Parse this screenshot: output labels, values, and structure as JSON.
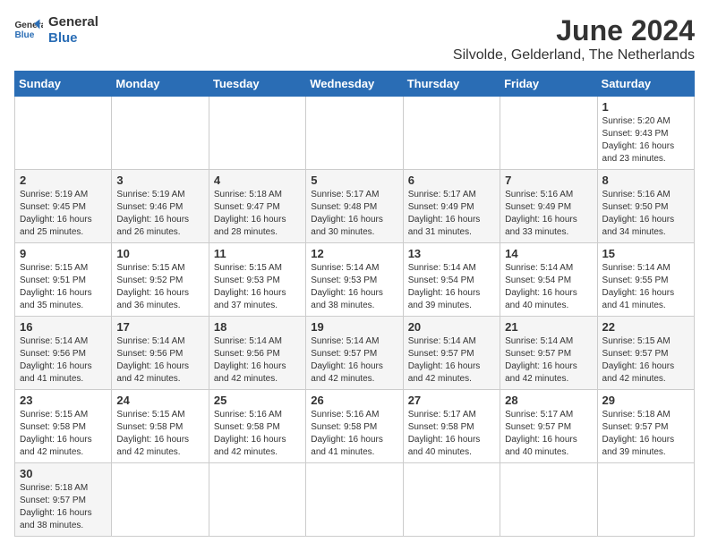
{
  "logo": {
    "line1": "General",
    "line2": "Blue"
  },
  "title": "June 2024",
  "subtitle": "Silvolde, Gelderland, The Netherlands",
  "weekdays": [
    "Sunday",
    "Monday",
    "Tuesday",
    "Wednesday",
    "Thursday",
    "Friday",
    "Saturday"
  ],
  "weeks": [
    [
      null,
      null,
      null,
      null,
      null,
      null,
      {
        "day": "1",
        "info": "Sunrise: 5:20 AM\nSunset: 9:43 PM\nDaylight: 16 hours\nand 23 minutes."
      }
    ],
    [
      {
        "day": "2",
        "info": "Sunrise: 5:19 AM\nSunset: 9:45 PM\nDaylight: 16 hours\nand 25 minutes."
      },
      {
        "day": "3",
        "info": "Sunrise: 5:19 AM\nSunset: 9:46 PM\nDaylight: 16 hours\nand 26 minutes."
      },
      {
        "day": "4",
        "info": "Sunrise: 5:18 AM\nSunset: 9:47 PM\nDaylight: 16 hours\nand 28 minutes."
      },
      {
        "day": "5",
        "info": "Sunrise: 5:17 AM\nSunset: 9:48 PM\nDaylight: 16 hours\nand 30 minutes."
      },
      {
        "day": "6",
        "info": "Sunrise: 5:17 AM\nSunset: 9:49 PM\nDaylight: 16 hours\nand 31 minutes."
      },
      {
        "day": "7",
        "info": "Sunrise: 5:16 AM\nSunset: 9:49 PM\nDaylight: 16 hours\nand 33 minutes."
      },
      {
        "day": "8",
        "info": "Sunrise: 5:16 AM\nSunset: 9:50 PM\nDaylight: 16 hours\nand 34 minutes."
      }
    ],
    [
      {
        "day": "9",
        "info": "Sunrise: 5:15 AM\nSunset: 9:51 PM\nDaylight: 16 hours\nand 35 minutes."
      },
      {
        "day": "10",
        "info": "Sunrise: 5:15 AM\nSunset: 9:52 PM\nDaylight: 16 hours\nand 36 minutes."
      },
      {
        "day": "11",
        "info": "Sunrise: 5:15 AM\nSunset: 9:53 PM\nDaylight: 16 hours\nand 37 minutes."
      },
      {
        "day": "12",
        "info": "Sunrise: 5:14 AM\nSunset: 9:53 PM\nDaylight: 16 hours\nand 38 minutes."
      },
      {
        "day": "13",
        "info": "Sunrise: 5:14 AM\nSunset: 9:54 PM\nDaylight: 16 hours\nand 39 minutes."
      },
      {
        "day": "14",
        "info": "Sunrise: 5:14 AM\nSunset: 9:54 PM\nDaylight: 16 hours\nand 40 minutes."
      },
      {
        "day": "15",
        "info": "Sunrise: 5:14 AM\nSunset: 9:55 PM\nDaylight: 16 hours\nand 41 minutes."
      }
    ],
    [
      {
        "day": "16",
        "info": "Sunrise: 5:14 AM\nSunset: 9:56 PM\nDaylight: 16 hours\nand 41 minutes."
      },
      {
        "day": "17",
        "info": "Sunrise: 5:14 AM\nSunset: 9:56 PM\nDaylight: 16 hours\nand 42 minutes."
      },
      {
        "day": "18",
        "info": "Sunrise: 5:14 AM\nSunset: 9:56 PM\nDaylight: 16 hours\nand 42 minutes."
      },
      {
        "day": "19",
        "info": "Sunrise: 5:14 AM\nSunset: 9:57 PM\nDaylight: 16 hours\nand 42 minutes."
      },
      {
        "day": "20",
        "info": "Sunrise: 5:14 AM\nSunset: 9:57 PM\nDaylight: 16 hours\nand 42 minutes."
      },
      {
        "day": "21",
        "info": "Sunrise: 5:14 AM\nSunset: 9:57 PM\nDaylight: 16 hours\nand 42 minutes."
      },
      {
        "day": "22",
        "info": "Sunrise: 5:15 AM\nSunset: 9:57 PM\nDaylight: 16 hours\nand 42 minutes."
      }
    ],
    [
      {
        "day": "23",
        "info": "Sunrise: 5:15 AM\nSunset: 9:58 PM\nDaylight: 16 hours\nand 42 minutes."
      },
      {
        "day": "24",
        "info": "Sunrise: 5:15 AM\nSunset: 9:58 PM\nDaylight: 16 hours\nand 42 minutes."
      },
      {
        "day": "25",
        "info": "Sunrise: 5:16 AM\nSunset: 9:58 PM\nDaylight: 16 hours\nand 42 minutes."
      },
      {
        "day": "26",
        "info": "Sunrise: 5:16 AM\nSunset: 9:58 PM\nDaylight: 16 hours\nand 41 minutes."
      },
      {
        "day": "27",
        "info": "Sunrise: 5:17 AM\nSunset: 9:58 PM\nDaylight: 16 hours\nand 40 minutes."
      },
      {
        "day": "28",
        "info": "Sunrise: 5:17 AM\nSunset: 9:57 PM\nDaylight: 16 hours\nand 40 minutes."
      },
      {
        "day": "29",
        "info": "Sunrise: 5:18 AM\nSunset: 9:57 PM\nDaylight: 16 hours\nand 39 minutes."
      }
    ],
    [
      {
        "day": "30",
        "info": "Sunrise: 5:18 AM\nSunset: 9:57 PM\nDaylight: 16 hours\nand 38 minutes."
      },
      null,
      null,
      null,
      null,
      null,
      null
    ]
  ]
}
